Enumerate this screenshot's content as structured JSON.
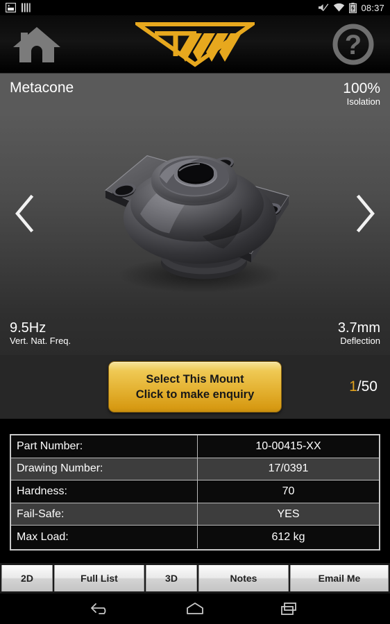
{
  "statusbar": {
    "time": "08:37",
    "icons_left": [
      "screenshot-icon",
      "bars-icon"
    ],
    "icons_right": [
      "mute-icon",
      "wifi-icon",
      "battery-charging-icon"
    ]
  },
  "header": {
    "home_icon": "home-icon",
    "logo_text": "T",
    "logo_name": "tww-logo",
    "help_icon": "help-icon"
  },
  "title": {
    "product_name": "Metacone",
    "isolation_value": "100%",
    "isolation_label": "Isolation"
  },
  "viewer": {
    "prev_icon": "chevron-left-icon",
    "next_icon": "chevron-right-icon",
    "product_image_name": "metacone-mount-render"
  },
  "specs": {
    "frequency_value": "9.5Hz",
    "frequency_label": "Vert. Nat. Freq.",
    "deflection_value": "3.7mm",
    "deflection_label": "Deflection"
  },
  "cta": {
    "line1": "Select This Mount",
    "line2": "Click to make enquiry",
    "counter_current": "1",
    "counter_total": "/50"
  },
  "table": {
    "rows": [
      {
        "key": "Part Number:",
        "value": "10-00415-XX"
      },
      {
        "key": "Drawing Number:",
        "value": "17/0391"
      },
      {
        "key": "Hardness:",
        "value": "70"
      },
      {
        "key": "Fail-Safe:",
        "value": "YES"
      },
      {
        "key": "Max Load:",
        "value": "612 kg"
      }
    ]
  },
  "tabs": [
    {
      "label": "2D"
    },
    {
      "label": "Full List"
    },
    {
      "label": "3D"
    },
    {
      "label": "Notes"
    },
    {
      "label": "Email Me"
    }
  ],
  "navbar": {
    "back_icon": "back-arrow-icon",
    "home_icon": "android-home-icon",
    "recents_icon": "recents-icon"
  },
  "colors": {
    "accent": "#e0a11c",
    "logo": "#e7a81e",
    "title_bar": "#5a5a5a",
    "table_border": "#c9c9c9"
  }
}
